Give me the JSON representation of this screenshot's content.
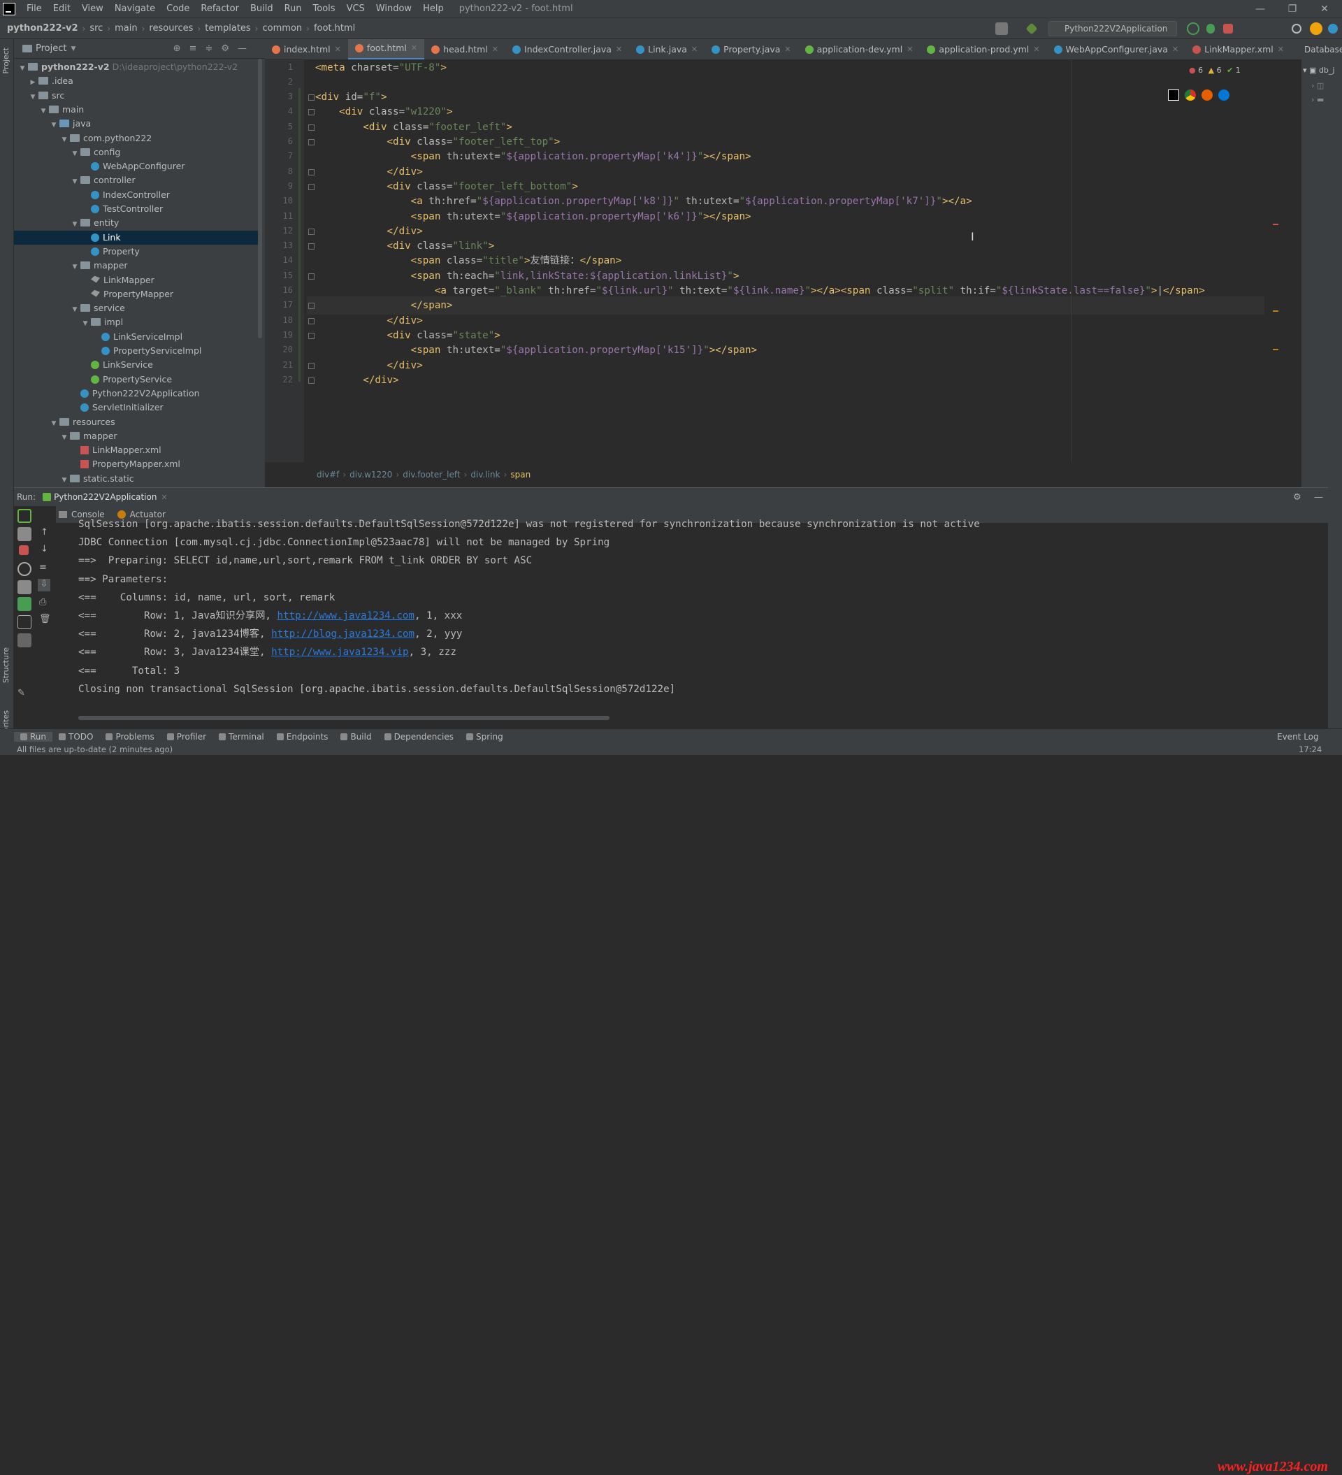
{
  "menubar": {
    "items": [
      "File",
      "Edit",
      "View",
      "Navigate",
      "Code",
      "Refactor",
      "Build",
      "Run",
      "Tools",
      "VCS",
      "Window",
      "Help"
    ],
    "title": "python222-v2 - foot.html"
  },
  "navbar": {
    "crumbs": [
      "python222-v2",
      "src",
      "main",
      "resources",
      "templates",
      "common",
      "foot.html"
    ],
    "run_config": "Python222V2Application"
  },
  "project": {
    "label": "Project",
    "tree": [
      {
        "label": "python222-v2",
        "dim": "D:\\ideaproject\\python222-v2",
        "depth": 0,
        "type": "folder",
        "bold": true
      },
      {
        "label": ".idea",
        "depth": 1,
        "type": "folder",
        "collapsed": true
      },
      {
        "label": "src",
        "depth": 1,
        "type": "folder"
      },
      {
        "label": "main",
        "depth": 2,
        "type": "folder"
      },
      {
        "label": "java",
        "depth": 3,
        "type": "folder-blue"
      },
      {
        "label": "com.python222",
        "depth": 4,
        "type": "folder"
      },
      {
        "label": "config",
        "depth": 5,
        "type": "folder"
      },
      {
        "label": "WebAppConfigurer",
        "depth": 6,
        "type": "class"
      },
      {
        "label": "controller",
        "depth": 5,
        "type": "folder"
      },
      {
        "label": "IndexController",
        "depth": 6,
        "type": "class"
      },
      {
        "label": "TestController",
        "depth": 6,
        "type": "class"
      },
      {
        "label": "entity",
        "depth": 5,
        "type": "folder"
      },
      {
        "label": "Link",
        "depth": 6,
        "type": "class",
        "selected": true
      },
      {
        "label": "Property",
        "depth": 6,
        "type": "class"
      },
      {
        "label": "mapper",
        "depth": 5,
        "type": "folder"
      },
      {
        "label": "LinkMapper",
        "depth": 6,
        "type": "bird"
      },
      {
        "label": "PropertyMapper",
        "depth": 6,
        "type": "bird"
      },
      {
        "label": "service",
        "depth": 5,
        "type": "folder"
      },
      {
        "label": "impl",
        "depth": 6,
        "type": "folder"
      },
      {
        "label": "LinkServiceImpl",
        "depth": 7,
        "type": "class"
      },
      {
        "label": "PropertyServiceImpl",
        "depth": 7,
        "type": "class"
      },
      {
        "label": "LinkService",
        "depth": 6,
        "type": "iface"
      },
      {
        "label": "PropertyService",
        "depth": 6,
        "type": "iface"
      },
      {
        "label": "Python222V2Application",
        "depth": 5,
        "type": "class"
      },
      {
        "label": "ServletInitializer",
        "depth": 5,
        "type": "class"
      },
      {
        "label": "resources",
        "depth": 3,
        "type": "folder"
      },
      {
        "label": "mapper",
        "depth": 4,
        "type": "folder"
      },
      {
        "label": "LinkMapper.xml",
        "depth": 5,
        "type": "xml"
      },
      {
        "label": "PropertyMapper.xml",
        "depth": 5,
        "type": "xml"
      },
      {
        "label": "static.static",
        "depth": 4,
        "type": "folder"
      }
    ]
  },
  "tabs": [
    {
      "label": "index.html",
      "color": "#e8754a"
    },
    {
      "label": "foot.html",
      "color": "#e8754a",
      "active": true
    },
    {
      "label": "head.html",
      "color": "#e8754a"
    },
    {
      "label": "IndexController.java",
      "color": "#3592c4"
    },
    {
      "label": "Link.java",
      "color": "#3592c4"
    },
    {
      "label": "Property.java",
      "color": "#3592c4"
    },
    {
      "label": "application-dev.yml",
      "color": "#62b543"
    },
    {
      "label": "application-prod.yml",
      "color": "#62b543"
    },
    {
      "label": "WebAppConfigurer.java",
      "color": "#3592c4"
    },
    {
      "label": "LinkMapper.xml",
      "color": "#c75450"
    }
  ],
  "right_panel": {
    "label": "Database",
    "item": "db_j"
  },
  "editor": {
    "inspections": {
      "errors": "6",
      "warnings": "6",
      "ok": "1"
    },
    "lines": [
      {
        "n": "1",
        "indent": "",
        "segs": [
          [
            "tag",
            "<meta "
          ],
          [
            "attr",
            "charset="
          ],
          [
            "val",
            "\"UTF-8\""
          ],
          [
            "tag",
            ">"
          ]
        ]
      },
      {
        "n": "2",
        "indent": "",
        "segs": []
      },
      {
        "n": "3",
        "indent": "",
        "segs": [
          [
            "tag",
            "<div "
          ],
          [
            "attr",
            "id="
          ],
          [
            "val",
            "\"f\""
          ],
          [
            "tag",
            ">"
          ]
        ]
      },
      {
        "n": "4",
        "indent": "    ",
        "segs": [
          [
            "tag",
            "<div "
          ],
          [
            "attr",
            "class="
          ],
          [
            "val",
            "\"w1220\""
          ],
          [
            "tag",
            ">"
          ]
        ]
      },
      {
        "n": "5",
        "indent": "        ",
        "segs": [
          [
            "tag",
            "<div "
          ],
          [
            "attr",
            "class="
          ],
          [
            "val",
            "\"footer_left\""
          ],
          [
            "tag",
            ">"
          ]
        ]
      },
      {
        "n": "6",
        "indent": "            ",
        "segs": [
          [
            "tag",
            "<div "
          ],
          [
            "attr",
            "class="
          ],
          [
            "val",
            "\"footer_left_top\""
          ],
          [
            "tag",
            ">"
          ]
        ]
      },
      {
        "n": "7",
        "indent": "                ",
        "segs": [
          [
            "tag",
            "<span "
          ],
          [
            "attr",
            "th:utext="
          ],
          [
            "val",
            "\""
          ],
          [
            "expr",
            "${application.propertyMap['k4']}"
          ],
          [
            "val",
            "\""
          ],
          [
            "tag",
            "></span>"
          ]
        ]
      },
      {
        "n": "8",
        "indent": "            ",
        "segs": [
          [
            "tag",
            "</div>"
          ]
        ]
      },
      {
        "n": "9",
        "indent": "            ",
        "segs": [
          [
            "tag",
            "<div "
          ],
          [
            "attr",
            "class="
          ],
          [
            "val",
            "\"footer_left_bottom\""
          ],
          [
            "tag",
            ">"
          ]
        ]
      },
      {
        "n": "10",
        "indent": "                ",
        "segs": [
          [
            "tag",
            "<a "
          ],
          [
            "attr",
            "th:href="
          ],
          [
            "val",
            "\""
          ],
          [
            "expr",
            "${application.propertyMap['k8']}"
          ],
          [
            "val",
            "\""
          ],
          [
            "attr",
            " th:utext="
          ],
          [
            "val",
            "\""
          ],
          [
            "expr",
            "${application.propertyMap['k7']}"
          ],
          [
            "val",
            "\""
          ],
          [
            "tag",
            "></a>"
          ]
        ]
      },
      {
        "n": "11",
        "indent": "                ",
        "segs": [
          [
            "tag",
            "<span "
          ],
          [
            "attr",
            "th:utext="
          ],
          [
            "val",
            "\""
          ],
          [
            "expr",
            "${application.propertyMap['k6']}"
          ],
          [
            "val",
            "\""
          ],
          [
            "tag",
            "></span>"
          ]
        ]
      },
      {
        "n": "12",
        "indent": "            ",
        "segs": [
          [
            "tag",
            "</div>"
          ]
        ]
      },
      {
        "n": "13",
        "indent": "            ",
        "segs": [
          [
            "tag",
            "<div "
          ],
          [
            "attr",
            "class="
          ],
          [
            "val",
            "\"link\""
          ],
          [
            "tag",
            ">"
          ]
        ]
      },
      {
        "n": "14",
        "indent": "                ",
        "segs": [
          [
            "tag",
            "<span "
          ],
          [
            "attr",
            "class="
          ],
          [
            "val",
            "\"title\""
          ],
          [
            "tag",
            ">"
          ],
          [
            "attr",
            "友情链接："
          ],
          [
            "tag",
            "</span>"
          ]
        ]
      },
      {
        "n": "15",
        "indent": "                ",
        "segs": [
          [
            "tag",
            "<span "
          ],
          [
            "attr",
            "th:each="
          ],
          [
            "val",
            "\""
          ],
          [
            "expr",
            "link,linkState:${application.linkList}"
          ],
          [
            "val",
            "\""
          ],
          [
            "tag",
            ">"
          ]
        ]
      },
      {
        "n": "16",
        "indent": "                    ",
        "segs": [
          [
            "tag",
            "<a "
          ],
          [
            "attr",
            "target="
          ],
          [
            "val",
            "\"_blank\""
          ],
          [
            "attr",
            " th:href="
          ],
          [
            "val",
            "\""
          ],
          [
            "expr",
            "${link.url}"
          ],
          [
            "val",
            "\""
          ],
          [
            "attr",
            " th:text="
          ],
          [
            "val",
            "\""
          ],
          [
            "expr",
            "${link.name}"
          ],
          [
            "val",
            "\""
          ],
          [
            "tag",
            "></a><span "
          ],
          [
            "attr",
            "class="
          ],
          [
            "val",
            "\"split\""
          ],
          [
            "attr",
            " th:if="
          ],
          [
            "val",
            "\""
          ],
          [
            "expr",
            "${linkState.last==false}"
          ],
          [
            "val",
            "\""
          ],
          [
            "tag",
            ">"
          ],
          [
            "attr",
            "|"
          ],
          [
            "tag",
            "</span>"
          ]
        ]
      },
      {
        "n": "17",
        "indent": "                ",
        "segs": [
          [
            "tag",
            "</span>"
          ]
        ]
      },
      {
        "n": "18",
        "indent": "            ",
        "segs": [
          [
            "tag",
            "</div>"
          ]
        ]
      },
      {
        "n": "19",
        "indent": "            ",
        "segs": [
          [
            "tag",
            "<div "
          ],
          [
            "attr",
            "class="
          ],
          [
            "val",
            "\"state\""
          ],
          [
            "tag",
            ">"
          ]
        ]
      },
      {
        "n": "20",
        "indent": "                ",
        "segs": [
          [
            "tag",
            "<span "
          ],
          [
            "attr",
            "th:utext="
          ],
          [
            "val",
            "\""
          ],
          [
            "expr",
            "${application.propertyMap['k15']}"
          ],
          [
            "val",
            "\""
          ],
          [
            "tag",
            "></span>"
          ]
        ]
      },
      {
        "n": "21",
        "indent": "            ",
        "segs": [
          [
            "tag",
            "</div>"
          ]
        ]
      },
      {
        "n": "22",
        "indent": "        ",
        "segs": [
          [
            "tag",
            "</div>"
          ]
        ]
      }
    ],
    "breadcrumb": [
      "div#f",
      "div.w1220",
      "div.footer_left",
      "div.link",
      "span"
    ]
  },
  "run": {
    "label": "Run:",
    "config": "Python222V2Application",
    "tabs": [
      "Console",
      "Actuator"
    ],
    "console": [
      {
        "t": "SqlSession [org.apache.ibatis.session.defaults.DefaultSqlSession@572d122e] was not registered for synchronization because synchronization is not active"
      },
      {
        "t": "JDBC Connection [com.mysql.cj.jdbc.ConnectionImpl@523aac78] will not be managed by Spring"
      },
      {
        "t": "==>  Preparing: SELECT id,name,url,sort,remark FROM t_link ORDER BY sort ASC"
      },
      {
        "t": "==> Parameters: "
      },
      {
        "t": "<==    Columns: id, name, url, sort, remark"
      },
      {
        "t": "<==        Row: 1, Java知识分享网, ",
        "link": "http://www.java1234.com",
        "tail": ", 1, xxx"
      },
      {
        "t": "<==        Row: 2, java1234博客, ",
        "link": "http://blog.java1234.com",
        "tail": ", 2, yyy"
      },
      {
        "t": "<==        Row: 3, Java1234课堂, ",
        "link": "http://www.java1234.vip",
        "tail": ", 3, zzz"
      },
      {
        "t": "<==      Total: 3"
      },
      {
        "t": "Closing non transactional SqlSession [org.apache.ibatis.session.defaults.DefaultSqlSession@572d122e]"
      }
    ]
  },
  "bottom_tabs": [
    "Run",
    "TODO",
    "Problems",
    "Profiler",
    "Terminal",
    "Endpoints",
    "Build",
    "Dependencies",
    "Spring"
  ],
  "event_log": "Event Log",
  "status": {
    "message": "All files are up-to-date (2 minutes ago)",
    "time": "17:24"
  },
  "left_labels": [
    "Project",
    "Structure",
    "Favorites"
  ],
  "watermark": "www.java1234.com",
  "colors": {
    "bg": "#2b2b2b",
    "panel": "#3c3f41",
    "accent": "#4a88c7",
    "tag": "#e8bf6a",
    "value": "#6a8759",
    "expr": "#9876aa"
  }
}
